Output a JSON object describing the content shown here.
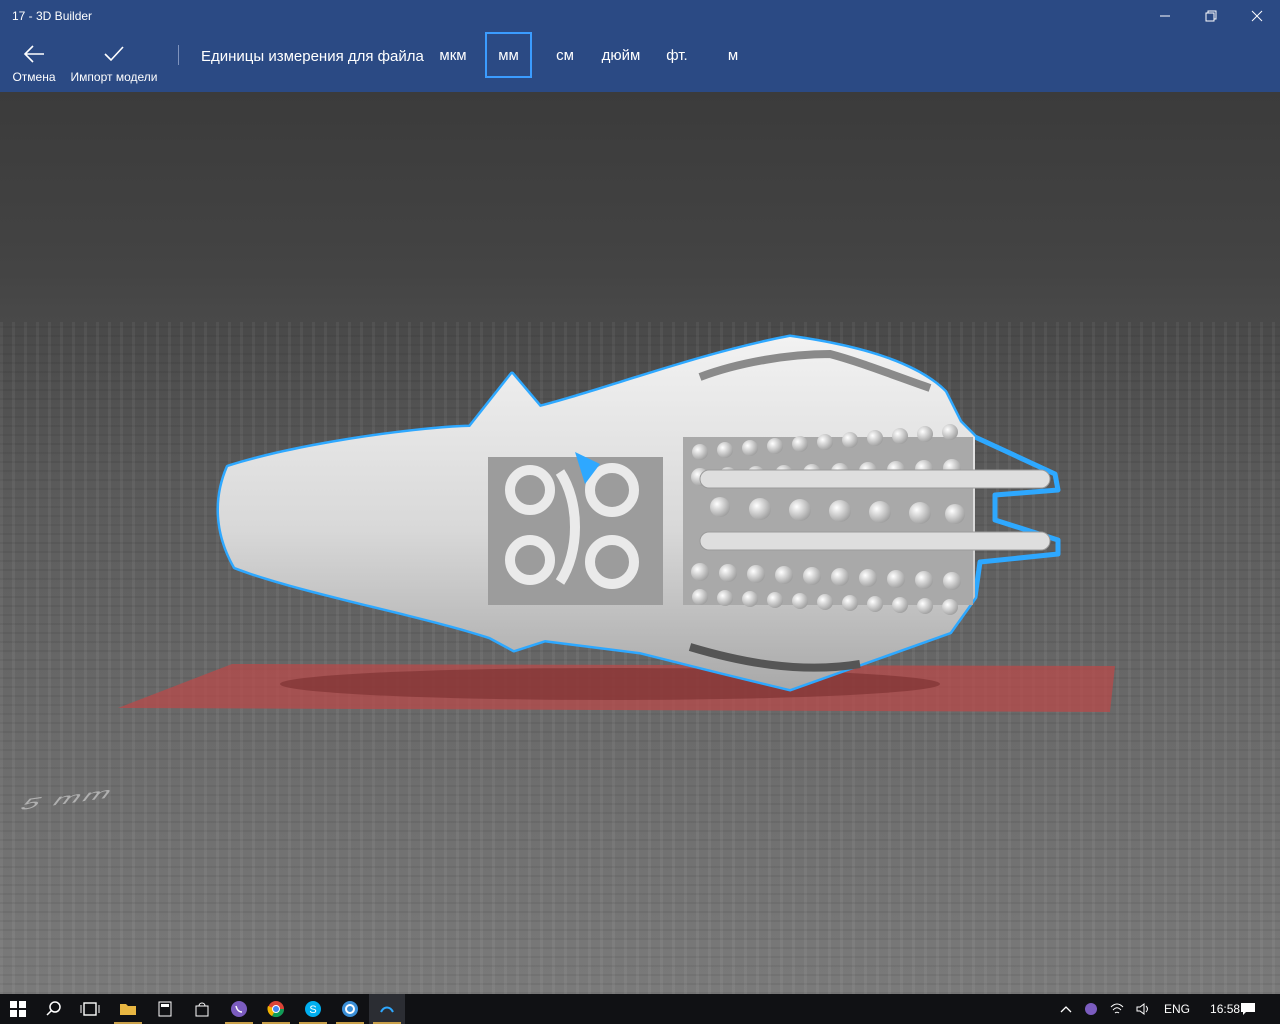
{
  "window": {
    "title": "17 - 3D Builder"
  },
  "toolbar": {
    "cancel_label": "Отмена",
    "import_label": "Импорт модели",
    "units_label": "Единицы измерения для файла",
    "units": [
      "мкм",
      "мм",
      "см",
      "дюйм",
      "фт.",
      "м"
    ],
    "selected_unit": "мм"
  },
  "viewport": {
    "floor_label": "5 mm"
  },
  "taskbar": {
    "language": "ENG",
    "time": "16:58"
  },
  "colors": {
    "accent": "#3b9cff",
    "appbar": "#2b4a84",
    "selection_outline": "#2ea8ff",
    "model": "#e6e6e6",
    "shadow_plane": "#b84a4a"
  }
}
